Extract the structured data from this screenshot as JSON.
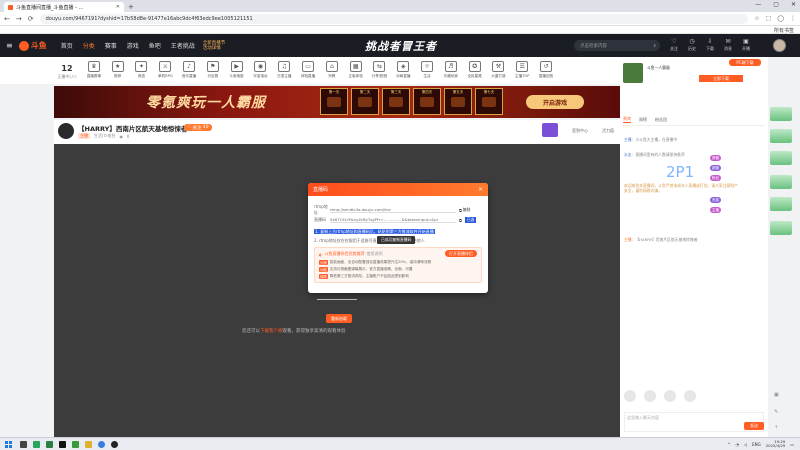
{
  "browser": {
    "tab_title": "斗鱼直播间直播_斗鱼直播 - ...",
    "url": "douyu.com/9467191?dyshid=17b58d8e-91477e16abc9dc4f63edc9ee1005121151",
    "bookmark": "所有书签"
  },
  "header": {
    "logo": "斗鱼",
    "nav": [
      "首页",
      "分类",
      "赛事",
      "游戏",
      "鱼吧",
      "王者挑战"
    ],
    "promo": [
      "全新直播节",
      "活动详情"
    ],
    "banner_title": "挑战者冒王者",
    "search_placeholder": "点击检索内容",
    "icons": [
      {
        "label": "关注",
        "icon": "heart-icon"
      },
      {
        "label": "历史",
        "icon": "clock-icon"
      },
      {
        "label": "下载",
        "icon": "download-icon"
      },
      {
        "label": "消息",
        "icon": "mail-icon"
      },
      {
        "label": "开播",
        "icon": "camera-icon"
      }
    ]
  },
  "categories": {
    "viewers": "12",
    "viewers_label": "正播中(人)",
    "items": [
      "直播赛事",
      "推荐",
      "竞技",
      "单机RPG",
      "音乐直播",
      "分区赛",
      "斗鱼电影",
      "宇宙电台",
      "日语主播",
      "体验直播",
      "宗教",
      "正版体验",
      "分享/配音",
      "对局直播",
      "生活",
      "乐器玩家",
      "全民星推",
      "大唐打造",
      "主播TOP",
      "直播回放"
    ]
  },
  "banner": {
    "main_text": "零氪爽玩一人霸服",
    "days": [
      "第一天",
      "第二天",
      "第三天",
      "第四天",
      "第五天",
      "第七天"
    ],
    "button": "开启游戏"
  },
  "stream": {
    "title": "【HARRY】西南片区航天基地惊悚者",
    "level": "Lv.13",
    "follow": "关注",
    "follow_count": "40",
    "sub_tag": "主播",
    "category": "生活/Ｄ电台",
    "plays": "0",
    "right_labels": [
      "活动礼包",
      "签到中心",
      "活力值"
    ],
    "stage_button": "重新加载",
    "stage_text_pre": "您还可以",
    "stage_text_link": "下载客户端",
    "stage_text_post": "观看，获得独享高清的观看体验"
  },
  "modal": {
    "title": "直播码",
    "rtmp_label": "rtmp地址",
    "rtmp_value": "rtmp://sendtc3a.douyu.com/live",
    "rtmp_copy": "复制",
    "key_label": "直播码",
    "key_value": "9467191rMcvyZcBy7sgPFr=...............&&tokenInput=&pr",
    "key_copy": "复制",
    "key_select": "已选",
    "selected_line": "1. 复制上方rtmp地址和直播码后，粘贴到第三方推流软件开始直播",
    "note_line": "2. rtmp地址仅在仅限用于此账号直播时使用，请勿泄露给他人",
    "tooltip": "已成功复制直播码",
    "tip_title": "斗鱼直播伴侣优势推荐",
    "tip_title_note": "使用说明",
    "tip_button": "打开直播伴侣",
    "tips": [
      {
        "tag": "分辨",
        "text": "智能画面，全自动配置强化直播效果提升达20%，保持清晰流畅"
      },
      {
        "tag": "功能",
        "text": "支持礼物截图弹幕展示，官方直播准确、全面、可靠"
      },
      {
        "tag": "保障",
        "text": "降低第三方推流风险，主播账户不会因此受到影响"
      }
    ]
  },
  "right": {
    "top_title": "斗鱼一人霸服",
    "top_button": "PC端下载",
    "top_button2": "立即下载",
    "tabs": [
      "贵宾",
      "周榜",
      "粉丝团"
    ],
    "chat": [
      {
        "user": "主播",
        "text": "小斗鱼大主播，在直播中"
      },
      {
        "user": "水友",
        "text": "直播间里有的人数请保持秩序"
      },
      {
        "user": "系统",
        "text": "欢迎来到本直播间，斗鱼严禁未成年人直播或打赏。请大家注意财产安全，谨防网络诈骗。"
      }
    ],
    "big_text": "2P1",
    "badges": [
      "房管",
      "超管",
      "粉丝",
      "贵族",
      "主播"
    ],
    "live_label": "主播",
    "live_desc": "【HARRY】西南片区航天基地惊悚者",
    "chat_input_placeholder": "这里输入聊天内容",
    "send": "发送"
  },
  "taskbar": {
    "tray_lang": "ENG",
    "time": "19:29",
    "date": "2025/4/29"
  },
  "colors": {
    "accent": "#ff5d23",
    "header_bg": "#1a1d24",
    "player_bg": "#3c3c3c",
    "selection": "#2c5ee0"
  }
}
